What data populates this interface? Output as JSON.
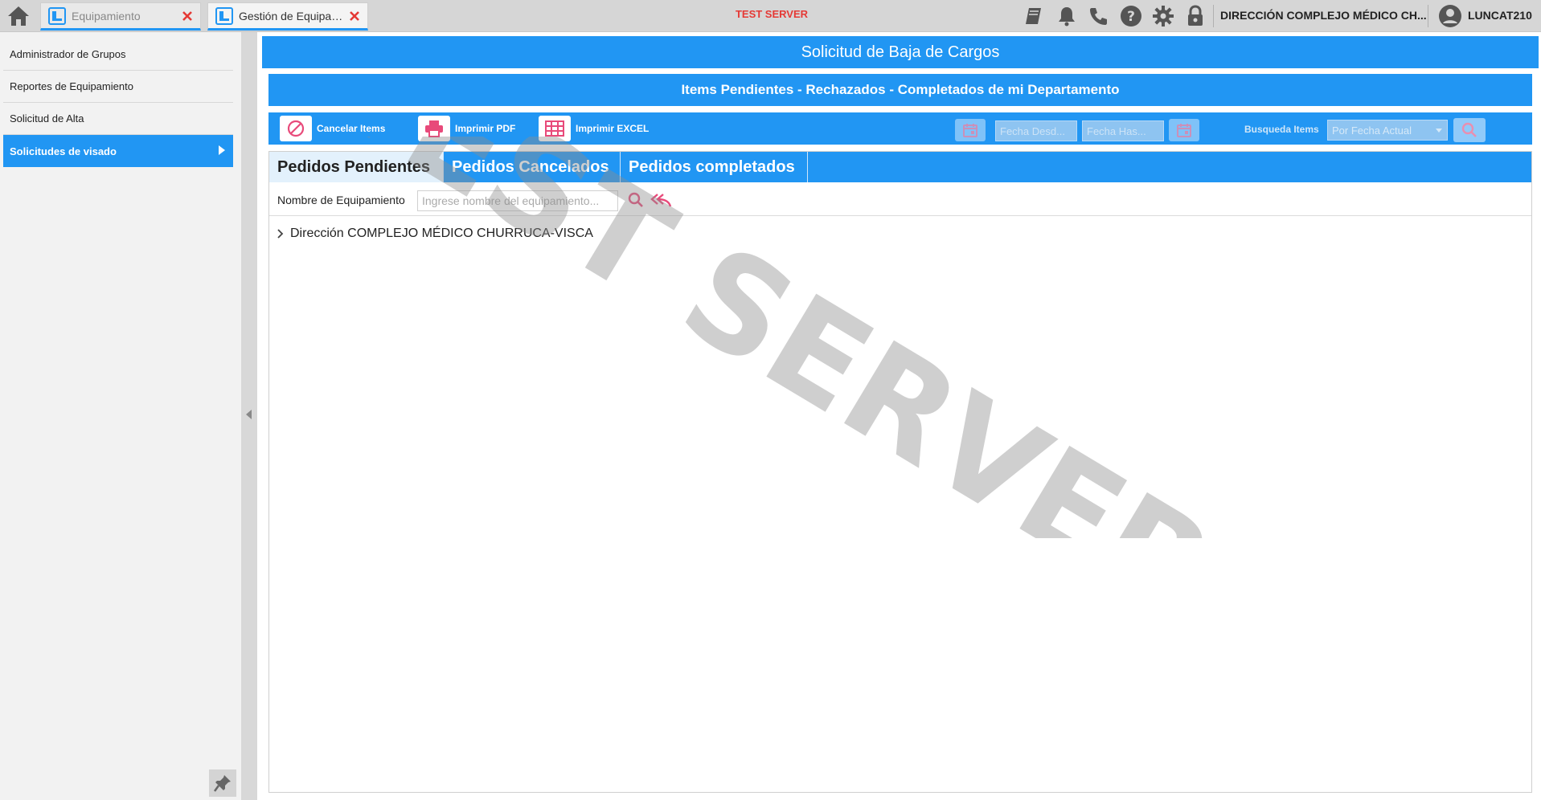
{
  "top_bar": {
    "tabs": [
      {
        "label": "Equipamiento"
      },
      {
        "label": "Gestión de Equipami..."
      }
    ],
    "server_label": "TEST SERVER",
    "department": "DIRECCIÓN COMPLEJO MÉDICO CH...",
    "user": "LUNCAT210",
    "icons": [
      "home-icon",
      "book-icon",
      "bell-icon",
      "phone-icon",
      "help-icon",
      "gear-icon",
      "lock-icon",
      "user-icon"
    ]
  },
  "sidebar": {
    "items": [
      {
        "label": "Administrador de Grupos"
      },
      {
        "label": "Reportes de Equipamiento"
      },
      {
        "label": "Solicitud de Alta"
      },
      {
        "label": "Solicitudes de visado"
      }
    ],
    "active_index": 3
  },
  "main": {
    "title": "Solicitud de Baja de Cargos",
    "subtitle": "Items Pendientes - Rechazados - Completados de mi Departamento",
    "toolbar": {
      "cancel_label": "Cancelar Items",
      "pdf_label": "Imprimir PDF",
      "excel_label": "Imprimir EXCEL",
      "date_from_placeholder": "Fecha Desd...",
      "date_to_placeholder": "Fecha Has...",
      "search_label": "Busqueda Items",
      "search_mode": "Por Fecha Actual"
    },
    "tabs": [
      {
        "label": "Pedidos Pendientes"
      },
      {
        "label": "Pedidos Cancelados"
      },
      {
        "label": "Pedidos completados"
      }
    ],
    "filter": {
      "label": "Nombre de Equipamiento",
      "placeholder": "Ingrese nombre del equipamiento..."
    },
    "tree": [
      {
        "label": "Dirección COMPLEJO MÉDICO CHURRUCA-VISCA"
      }
    ]
  },
  "watermark": "TEST SERVER",
  "colors": {
    "accent": "#2196f3",
    "danger": "#e53935",
    "icon_pink": "#e84a7a"
  }
}
